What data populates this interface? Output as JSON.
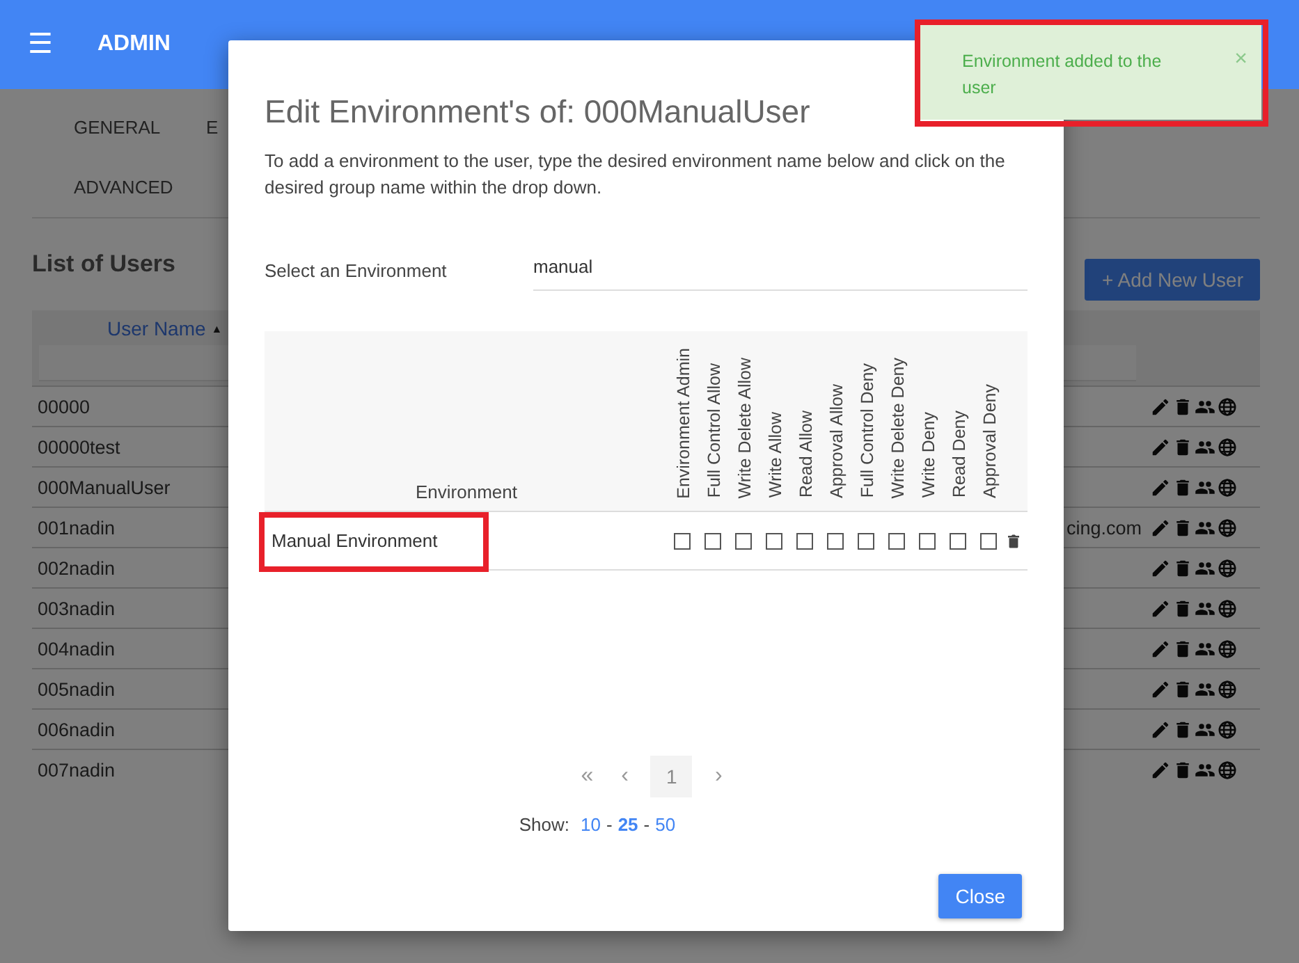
{
  "app_bar": {
    "menu_icon": "☰",
    "title": "ADMIN"
  },
  "tabs": [
    {
      "label": "GENERAL",
      "selected": false
    },
    {
      "label": "E",
      "selected": false
    },
    {
      "label": "ADVANCED",
      "selected": false
    }
  ],
  "users_section": {
    "title": "List of Users",
    "add_button": "+ Add New User"
  },
  "users_table": {
    "columns": [
      {
        "label": "User Name",
        "sort_icon": "▲"
      }
    ],
    "rows": [
      {
        "user_name": "00000"
      },
      {
        "user_name": "00000test"
      },
      {
        "user_name": "000ManualUser"
      },
      {
        "user_name": "001nadin",
        "column_2": "cing.com"
      },
      {
        "user_name": "002nadin"
      },
      {
        "user_name": "003nadin"
      },
      {
        "user_name": "004nadin"
      },
      {
        "user_name": "005nadin"
      },
      {
        "user_name": "006nadin"
      },
      {
        "user_name": "007nadin"
      }
    ]
  },
  "dialog": {
    "title": "Edit Environment's of: 000ManualUser",
    "description": "To add a environment to the user, type the desired environment name below and click on the desired group name within the drop down.",
    "field": {
      "label": "Select an Environment",
      "value": "manual"
    },
    "table": {
      "first_column": "Environment",
      "permission_columns": [
        "Environment Admin",
        "Full Control Allow",
        "Write Delete Allow",
        "Write Allow",
        "Read Allow",
        "Approval Allow",
        "Full Control Deny",
        "Write Delete Deny",
        "Write Deny",
        "Read Deny",
        "Approval Deny"
      ],
      "rows": [
        {
          "environment": "Manual Environment",
          "highlighted": true,
          "permissions": [
            {
              "checked": false
            },
            {
              "checked": false
            },
            {
              "checked": false
            },
            {
              "checked": false
            },
            {
              "checked": false
            },
            {
              "checked": false
            },
            {
              "checked": false
            },
            {
              "checked": false
            },
            {
              "checked": false
            },
            {
              "checked": false
            },
            {
              "checked": false
            }
          ]
        }
      ]
    },
    "pagination": {
      "first": "«",
      "prev": "‹",
      "pages": [
        {
          "label": "1",
          "selected": true
        }
      ],
      "next": "›"
    },
    "page_size": {
      "label": "Show:",
      "separator": "-",
      "options": [
        {
          "label": "10",
          "selected": false
        },
        {
          "label": "25",
          "selected": true
        },
        {
          "label": "50",
          "selected": false
        }
      ]
    },
    "close_button": "Close"
  },
  "toast": {
    "message": "Environment added to the user",
    "close": "×",
    "highlighted": true
  }
}
